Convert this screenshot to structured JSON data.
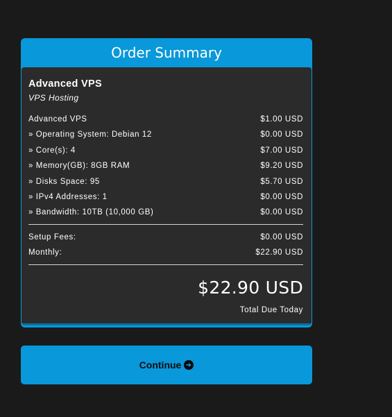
{
  "summary": {
    "title": "Order Summary",
    "product_name": "Advanced VPS",
    "product_group": "VPS Hosting",
    "lines": [
      {
        "label": "Advanced VPS",
        "price": "$1.00 USD"
      },
      {
        "label": "» Operating System: Debian 12",
        "price": "$0.00 USD"
      },
      {
        "label": "» Core(s): 4",
        "price": "$7.00 USD"
      },
      {
        "label": "» Memory(GB): 8GB RAM",
        "price": "$9.20 USD"
      },
      {
        "label": "» Disks Space: 95",
        "price": "$5.70 USD"
      },
      {
        "label": "» IPv4 Addresses: 1",
        "price": "$0.00 USD"
      },
      {
        "label": "» Bandwidth: 10TB (10,000 GB)",
        "price": "$0.00 USD"
      }
    ],
    "setup_fees_label": "Setup Fees:",
    "setup_fees_value": "$0.00 USD",
    "monthly_label": "Monthly:",
    "monthly_value": "$22.90 USD",
    "total_amount": "$22.90 USD",
    "total_label": "Total Due Today"
  },
  "continue_button": {
    "label": "Continue",
    "icon": "arrow-circle-right-icon"
  },
  "colors": {
    "background": "#1a1a1a",
    "accent": "#0998d9",
    "panel": "#2b2b2b",
    "text": "#ffffff"
  }
}
